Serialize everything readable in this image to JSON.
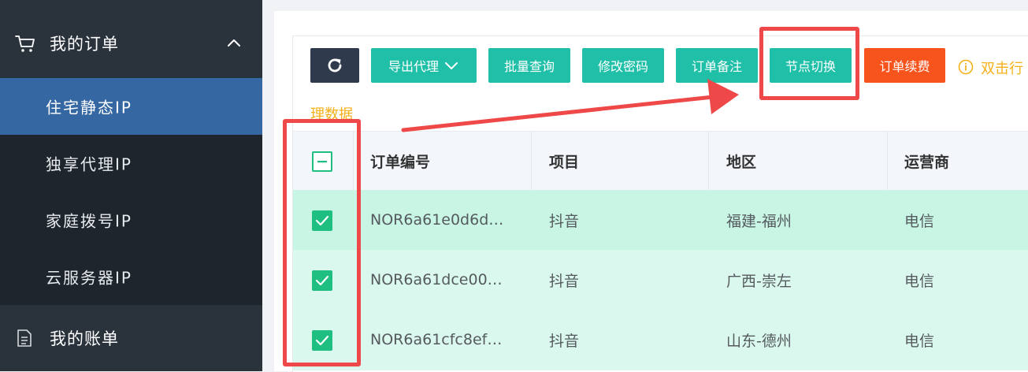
{
  "sidebar": {
    "orders_group": {
      "label": "我的订单",
      "icon": "cart-icon",
      "chevron": "chevron-up-icon"
    },
    "items": [
      {
        "label": "住宅静态IP",
        "active": true
      },
      {
        "label": "独享代理IP",
        "active": false
      },
      {
        "label": "家庭拨号IP",
        "active": false
      },
      {
        "label": "云服务器IP",
        "active": false
      }
    ],
    "bills_group": {
      "label": "我的账单",
      "icon": "document-icon"
    }
  },
  "toolbar": {
    "refresh_icon": "refresh-icon",
    "export_label": "导出代理",
    "export_icon": "chevron-down-icon",
    "batch_query_label": "批量查询",
    "change_password_label": "修改密码",
    "order_note_label": "订单备注",
    "node_switch_label": "节点切换",
    "renew_label": "订单续费",
    "hint_icon": "info-icon",
    "hint_part1": "双击行",
    "hint_part2": "理数据"
  },
  "table": {
    "columns": [
      "订单编号",
      "项目",
      "地区",
      "运营商"
    ],
    "rows": [
      {
        "checked": true,
        "order_id": "NOR6a61e0d6d…",
        "project": "抖音",
        "region": "福建-福州",
        "carrier": "电信"
      },
      {
        "checked": true,
        "order_id": "NOR6a61dce00…",
        "project": "抖音",
        "region": "广西-崇左",
        "carrier": "电信"
      },
      {
        "checked": true,
        "order_id": "NOR6a61cfc8ef…",
        "project": "抖音",
        "region": "山东-德州",
        "carrier": "电信"
      }
    ]
  },
  "colors": {
    "sidebar_bg": "#2a323c",
    "sidebar_active": "#3568a3",
    "teal_button": "#1fbfa8",
    "orange_button": "#f6531d",
    "check_green": "#1fbf82",
    "hint_yellow": "#f5b018",
    "annotation_red": "#ee4848"
  }
}
